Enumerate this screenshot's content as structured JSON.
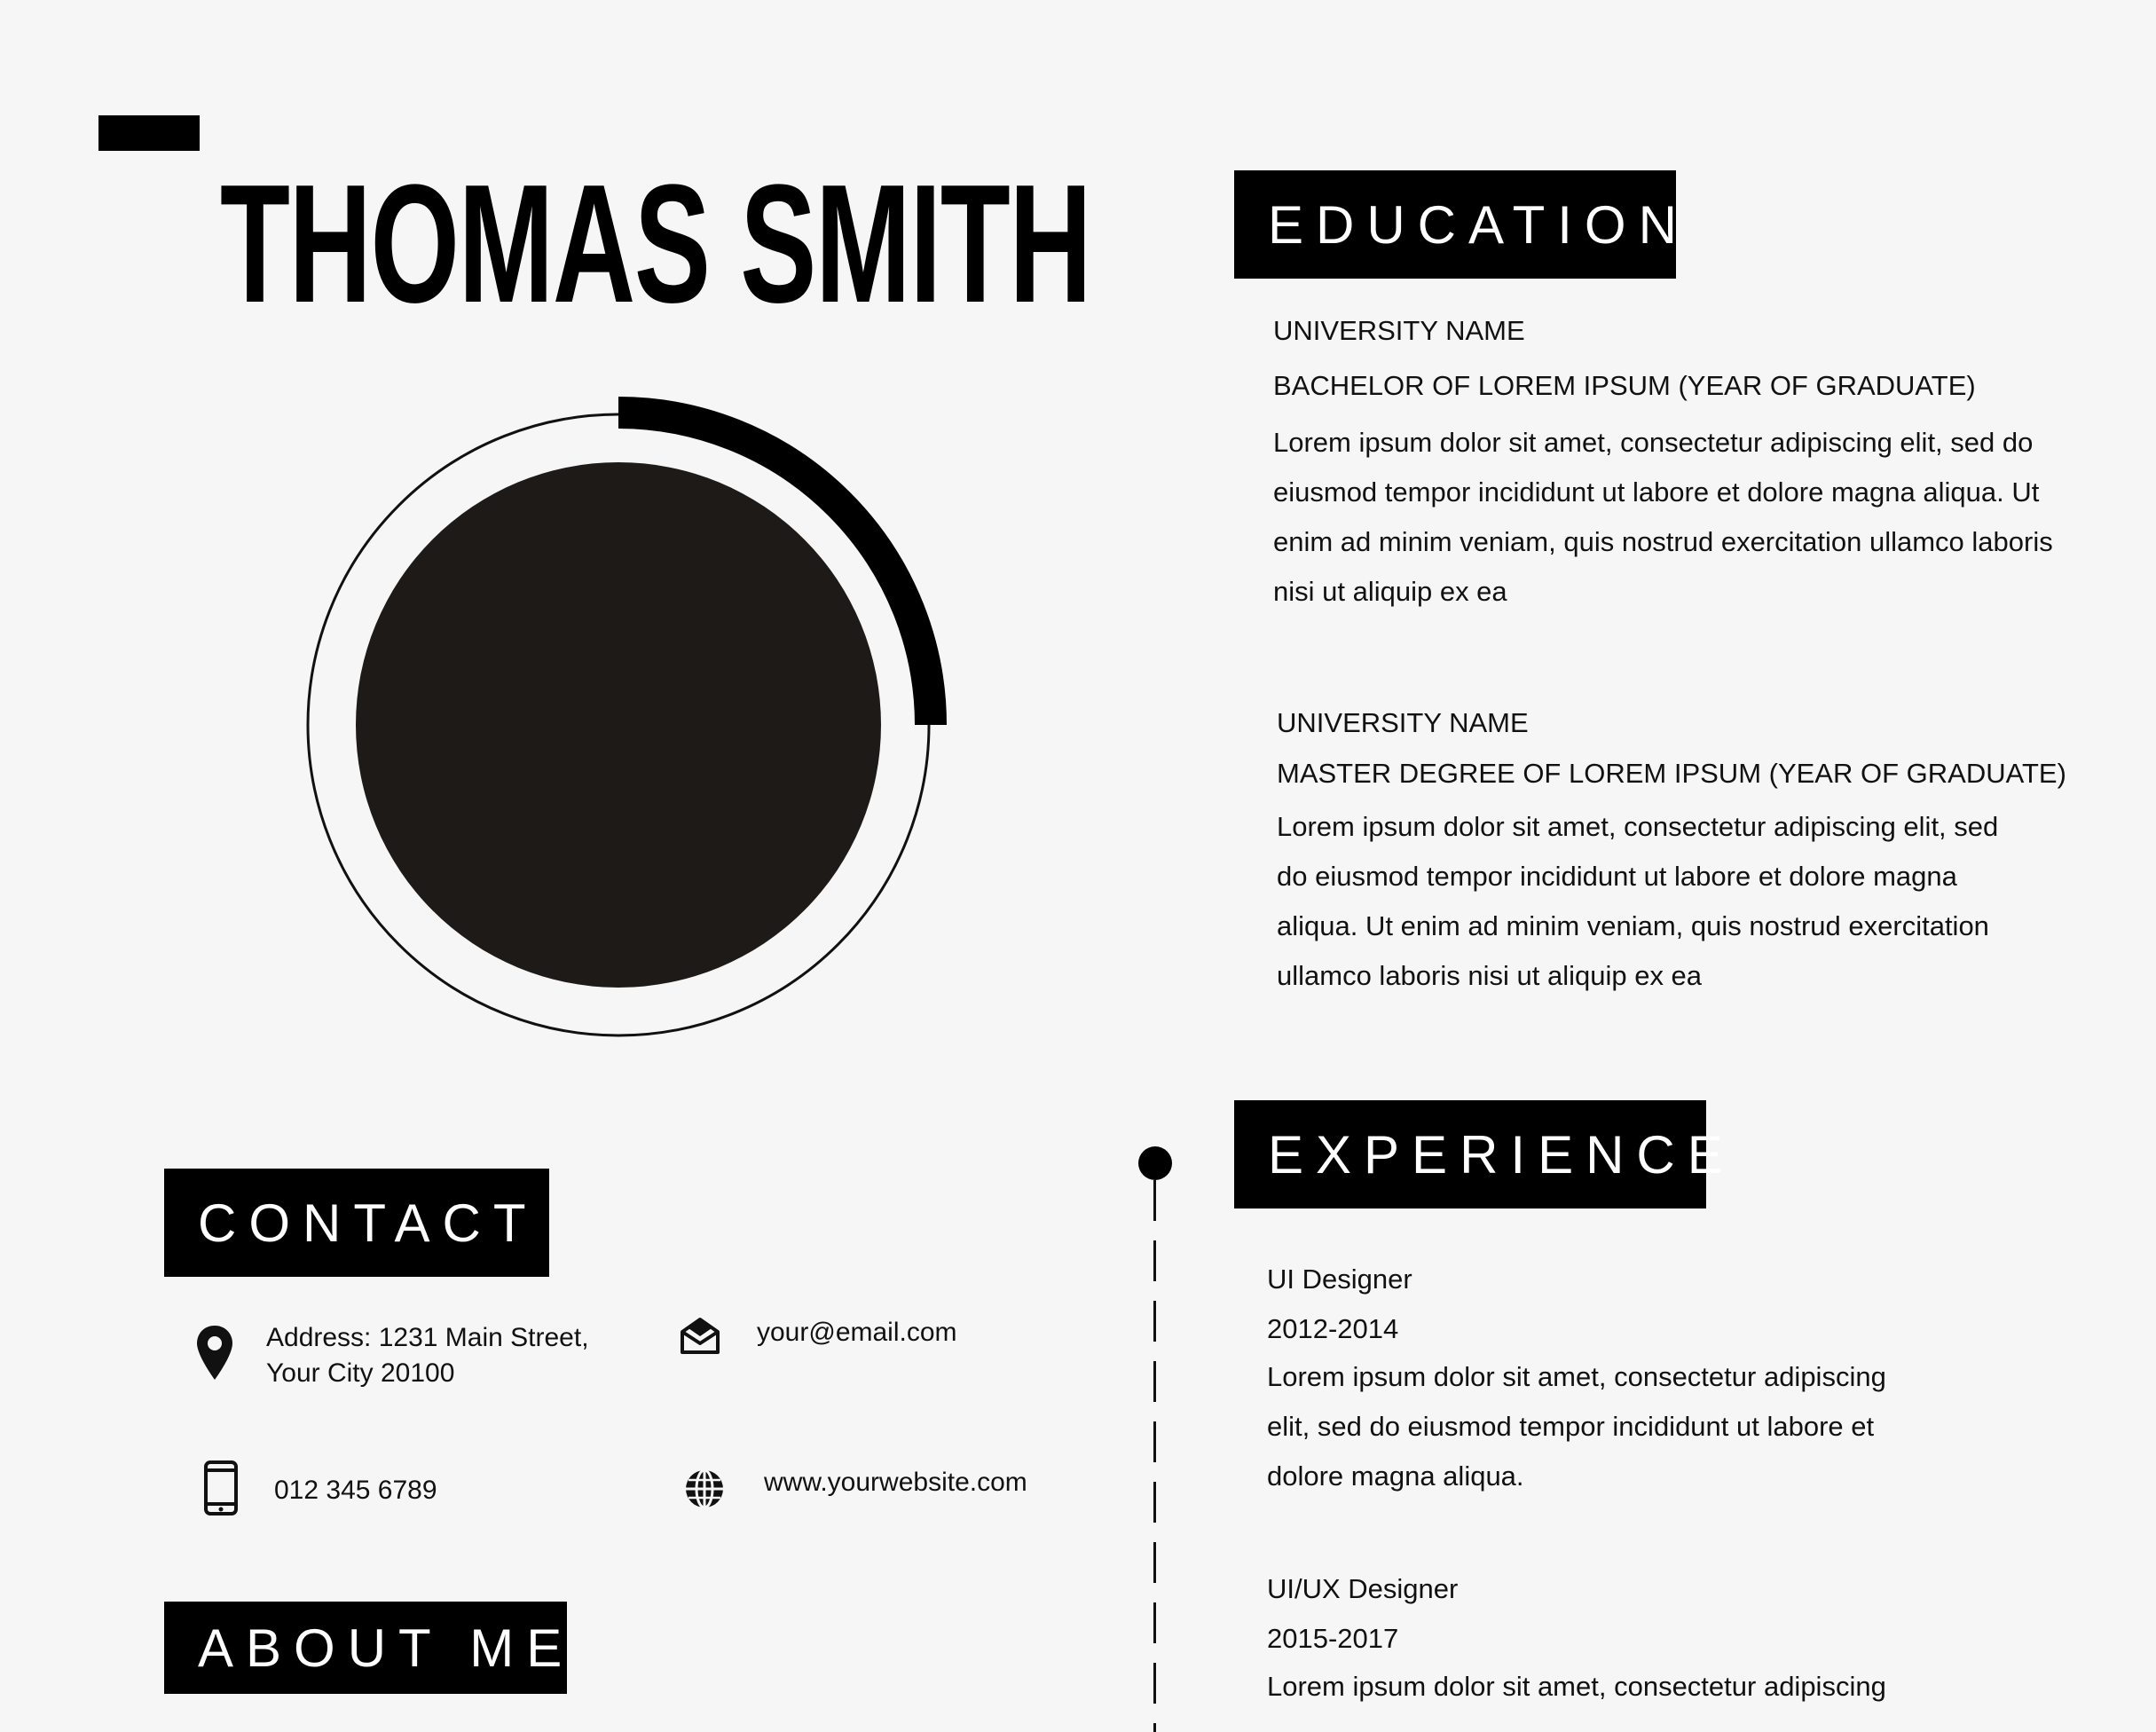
{
  "resume": {
    "name": "THOMAS SMITH"
  },
  "photo": {
    "progress_fraction": 0.25
  },
  "education": {
    "heading": "EDUCATION",
    "entries": [
      {
        "school": "UNIVERSITY NAME",
        "degree": "BACHELOR OF LOREM IPSUM (YEAR OF GRADUATE)",
        "lines": [
          "Lorem ipsum dolor sit amet, consectetur adipiscing elit, sed do",
          "eiusmod tempor incididunt ut labore et dolore magna aliqua. Ut",
          "enim ad minim veniam, quis nostrud exercitation ullamco laboris",
          "nisi ut aliquip ex ea"
        ]
      },
      {
        "school": "UNIVERSITY NAME",
        "degree": "MASTER DEGREE OF LOREM IPSUM (YEAR OF GRADUATE)",
        "lines": [
          "Lorem ipsum dolor sit amet, consectetur adipiscing elit, sed",
          "do eiusmod tempor incididunt ut labore et dolore magna",
          "aliqua. Ut enim ad minim veniam, quis nostrud exercitation",
          "ullamco laboris nisi ut aliquip ex ea"
        ]
      }
    ]
  },
  "experience": {
    "heading": "EXPERIENCE",
    "entries": [
      {
        "role": "UI Designer",
        "years": "2012-2014",
        "lines": [
          "Lorem ipsum dolor sit amet, consectetur adipiscing",
          "elit, sed do eiusmod tempor incididunt ut labore et",
          "dolore magna aliqua."
        ]
      },
      {
        "role": "UI/UX Designer",
        "years": "2015-2017",
        "lines": [
          "Lorem ipsum dolor sit amet, consectetur adipiscing"
        ]
      }
    ]
  },
  "contact": {
    "heading": "CONTACT",
    "address_line1": "Address: 1231 Main Street,",
    "address_line2": "Your City 20100",
    "email": "your@email.com",
    "phone": "012 345 6789",
    "website": "www.yourwebsite.com",
    "icons": {
      "address": "location-pin-icon",
      "email": "envelope-icon",
      "phone": "mobile-phone-icon",
      "website": "globe-icon"
    }
  },
  "about": {
    "heading": "ABOUT ME"
  },
  "colors": {
    "accent": "#000000",
    "photo_fill": "#1e1a18",
    "background": "#f6f6f6"
  }
}
